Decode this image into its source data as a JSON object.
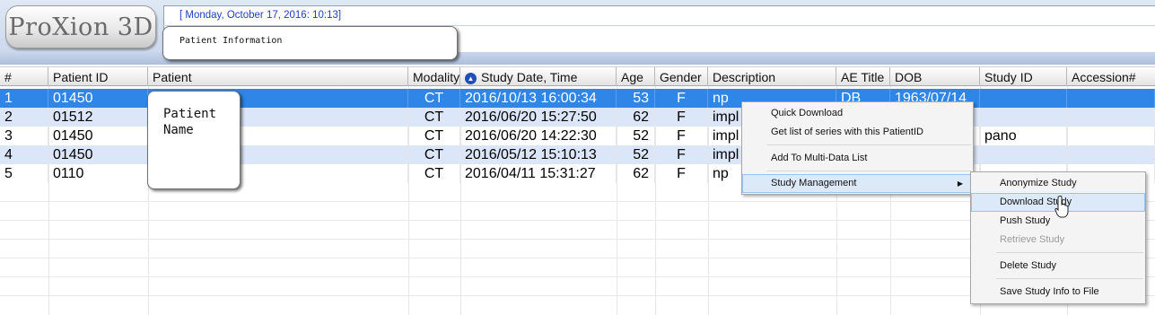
{
  "header": {
    "logo_text": "ProXion 3D",
    "datetime": "[ Monday, October 17, 2016: 10:13]",
    "patient_info_label": "Patient Information"
  },
  "callouts": {
    "patient_name": [
      "Patient",
      "Name"
    ]
  },
  "table": {
    "columns": [
      "#",
      "Patient ID",
      "Patient",
      "Modality",
      "Study Date, Time",
      "Age",
      "Gender",
      "Description",
      "AE Title",
      "DOB",
      "Study ID",
      "Accession#"
    ],
    "rows": [
      {
        "num": "1",
        "patient_id": "01450",
        "patient": "",
        "modality": "CT",
        "study_date": "2016/10/13 16:00:34",
        "age": "53",
        "gender": "F",
        "description": "np",
        "ae_title": "DB",
        "dob": "1963/07/14",
        "study_id": "",
        "accession": ""
      },
      {
        "num": "2",
        "patient_id": "01512",
        "patient": "",
        "modality": "CT",
        "study_date": "2016/06/20 15:27:50",
        "age": "62",
        "gender": "F",
        "description": "impl",
        "ae_title": "",
        "dob": "",
        "study_id": "",
        "accession": ""
      },
      {
        "num": "3",
        "patient_id": "01450",
        "patient": "",
        "modality": "CT",
        "study_date": "2016/06/20 14:22:30",
        "age": "52",
        "gender": "F",
        "description": "impl",
        "ae_title": "",
        "dob": "",
        "study_id": "pano",
        "accession": ""
      },
      {
        "num": "4",
        "patient_id": "01450",
        "patient": "",
        "modality": "CT",
        "study_date": "2016/05/12 15:10:13",
        "age": "52",
        "gender": "F",
        "description": "impl",
        "ae_title": "",
        "dob": "",
        "study_id": "",
        "accession": ""
      },
      {
        "num": "5",
        "patient_id": "0110",
        "patient": "",
        "modality": "CT",
        "study_date": "2016/04/11 15:31:27",
        "age": "62",
        "gender": "F",
        "description": "np",
        "ae_title": "",
        "dob": "",
        "study_id": "",
        "accession": ""
      }
    ],
    "selected_row": 1,
    "sort_column": "Study Date, Time"
  },
  "context_menu": {
    "items": [
      "Quick Download",
      "Get list of series with this PatientID",
      "Add To Multi-Data List",
      "Study Management"
    ]
  },
  "submenu": {
    "items": [
      "Anonymize Study",
      "Download Study",
      "Push Study",
      "Retrieve Study",
      "Delete Study",
      "Save Study Info to File"
    ],
    "highlighted": "Download Study",
    "disabled": [
      "Retrieve Study"
    ]
  },
  "colors": {
    "selection": "#2f86e6",
    "alt_row": "#dbe7f8",
    "datetime_text": "#1f3fbf"
  }
}
